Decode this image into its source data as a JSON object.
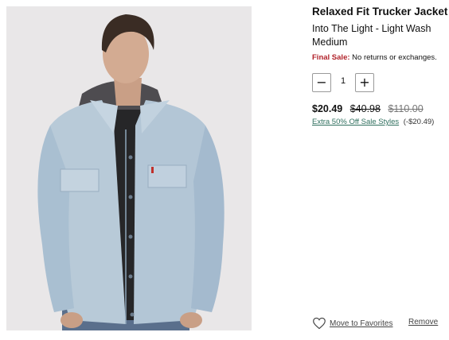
{
  "product": {
    "title": "Relaxed Fit Trucker Jacket",
    "color": "Into The Light - Light Wash",
    "size": "Medium",
    "final_sale_label": "Final Sale:",
    "final_sale_text": "No returns or exchanges."
  },
  "quantity": {
    "minus_label": "−",
    "value": "1",
    "plus_label": "+"
  },
  "pricing": {
    "sale_price": "$20.49",
    "original_price": "$40.98",
    "list_price": "$110.00",
    "promo_link": "Extra 50% Off Sale Styles",
    "promo_amount": "(-$20.49)"
  },
  "actions": {
    "favorites_label": "Move to Favorites",
    "remove_label": "Remove"
  },
  "colors": {
    "final_sale": "#b1222a",
    "promo_link": "#2f6f5e",
    "image_bg": "#e9e7e8"
  },
  "icons": {
    "favorites": "heart-outline-icon"
  }
}
